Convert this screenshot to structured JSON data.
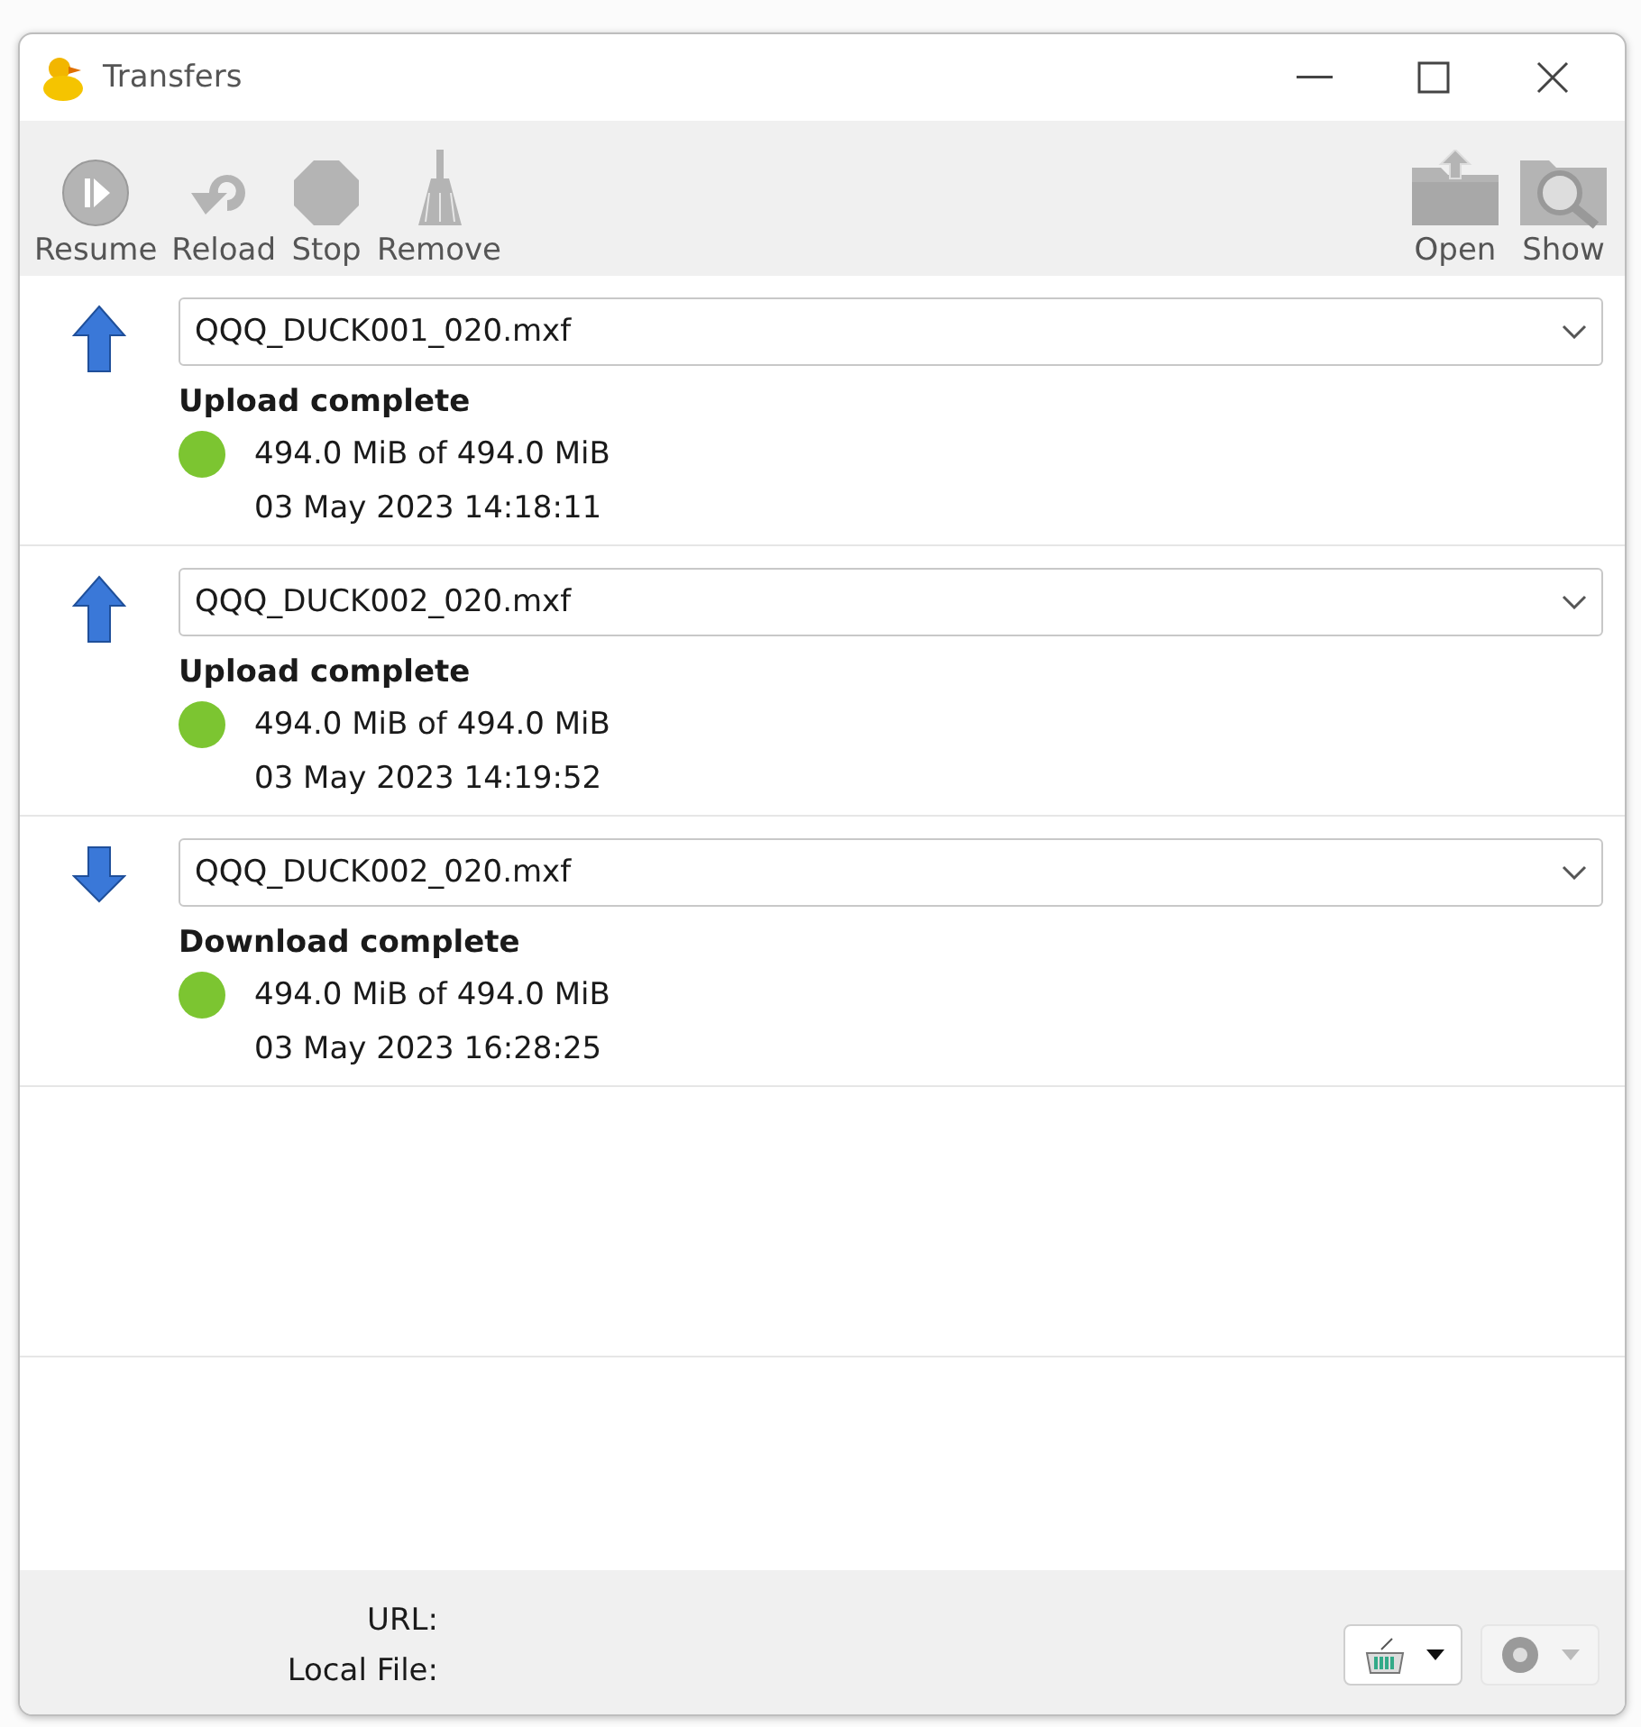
{
  "window": {
    "title": "Transfers"
  },
  "toolbar": {
    "left": [
      {
        "label": "Resume",
        "kind": "resume",
        "disabled": true
      },
      {
        "label": "Reload",
        "kind": "reload",
        "disabled": true
      },
      {
        "label": "Stop",
        "kind": "stop",
        "disabled": true
      },
      {
        "label": "Remove",
        "kind": "remove",
        "disabled": true
      }
    ],
    "right": [
      {
        "label": "Open",
        "kind": "open",
        "disabled": true
      },
      {
        "label": "Show",
        "kind": "show",
        "disabled": true
      }
    ]
  },
  "transfers": [
    {
      "kind": "upload",
      "file": "QQQ_DUCK001_020.mxf",
      "status": "Upload complete",
      "color": "#7cc531",
      "size": "494.0 MiB of 494.0 MiB",
      "time": "03 May 2023 14:18:11"
    },
    {
      "kind": "upload",
      "file": "QQQ_DUCK002_020.mxf",
      "status": "Upload complete",
      "color": "#7cc531",
      "size": "494.0 MiB of 494.0 MiB",
      "time": "03 May 2023 14:19:52"
    },
    {
      "kind": "download",
      "file": "QQQ_DUCK002_020.mxf",
      "status": "Download complete",
      "color": "#7cc531",
      "size": "494.0 MiB of 494.0 MiB",
      "time": "03 May 2023 16:28:25"
    }
  ],
  "footer": {
    "url_label": "URL:",
    "local_label": "Local File:",
    "bandwidth_disabled": false,
    "connections_disabled": true
  }
}
